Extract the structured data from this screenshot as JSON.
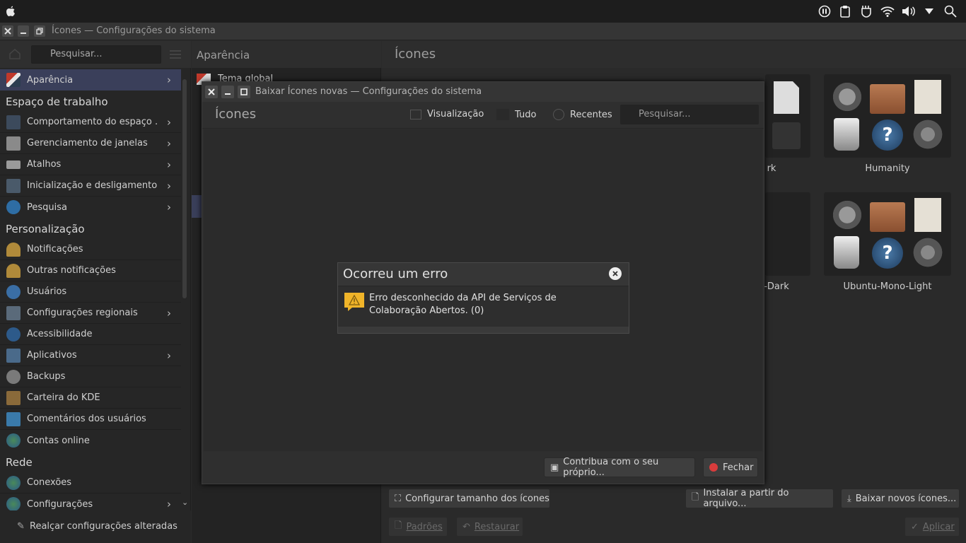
{
  "window": {
    "title": "Ícones — Configurações do sistema"
  },
  "sidebar": {
    "search_placeholder": "Pesquisar...",
    "active_item": "Aparência",
    "sections": {
      "workspace": "Espaço de trabalho",
      "personalization": "Personalização",
      "network": "Rede"
    },
    "items": [
      {
        "label": "Comportamento do espaço ...",
        "icon": "workspace-behavior-icon"
      },
      {
        "label": "Gerenciamento de janelas",
        "icon": "window-management-icon"
      },
      {
        "label": "Atalhos",
        "icon": "keyboard-icon"
      },
      {
        "label": "Inicialização e desligamento",
        "icon": "startup-icon"
      },
      {
        "label": "Pesquisa",
        "icon": "search-icon"
      },
      {
        "label": "Notificações",
        "icon": "bell-icon"
      },
      {
        "label": "Outras notificações",
        "icon": "bell-icon"
      },
      {
        "label": "Usuários",
        "icon": "users-icon"
      },
      {
        "label": "Configurações regionais",
        "icon": "regional-icon"
      },
      {
        "label": "Acessibilidade",
        "icon": "accessibility-icon"
      },
      {
        "label": "Aplicativos",
        "icon": "applications-icon"
      },
      {
        "label": "Backups",
        "icon": "backup-icon"
      },
      {
        "label": "Carteira do KDE",
        "icon": "wallet-icon"
      },
      {
        "label": "Comentários dos usuários",
        "icon": "feedback-icon"
      },
      {
        "label": "Contas online",
        "icon": "globe-icon"
      },
      {
        "label": "Conexões",
        "icon": "globe-icon"
      },
      {
        "label": "Configurações",
        "icon": "globe-icon"
      }
    ],
    "highlight_button": "Realçar configurações alteradas"
  },
  "middle": {
    "header": "Aparência",
    "first_item": "Tema global"
  },
  "right": {
    "header": "Ícones",
    "themes": [
      "Humanity",
      "Ubuntu-Mono-Light"
    ],
    "partial_labels": [
      "rk",
      "-Dark"
    ],
    "buttons": {
      "configure_size": "Configurar tamanho dos ícones",
      "install_file": "Instalar a partir do arquivo...",
      "download_new": "Baixar novos ícones...",
      "defaults": "Padrões",
      "reset": "Restaurar",
      "apply": "Aplicar"
    }
  },
  "dialog": {
    "title": "Baixar Ícones novas — Configurações do sistema",
    "header": "Ícones",
    "toolbar": {
      "view": "Visualização",
      "all": "Tudo",
      "recent": "Recentes",
      "search_placeholder": "Pesquisar..."
    },
    "contribute": "Contribua com o seu próprio...",
    "close": "Fechar"
  },
  "error": {
    "title": "Ocorreu um erro",
    "message": "Erro desconhecido da API de Serviços de Colaboração Abertos. (0)"
  },
  "colors": {
    "accent": "#3a3f5a",
    "warning": "#f0b429",
    "close_red": "#d83c3c"
  }
}
